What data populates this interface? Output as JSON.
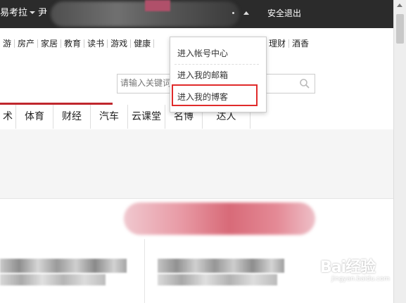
{
  "topbar": {
    "username": "易考拉",
    "user_suffix": "尹",
    "logout_label": "安全退出"
  },
  "nav_categories": [
    "游",
    "房产",
    "家居",
    "教育",
    "读书",
    "游戏",
    "健康",
    "理财",
    "酒香"
  ],
  "search": {
    "placeholder": "请输入关键词"
  },
  "tabs": [
    {
      "label": "术"
    },
    {
      "label": "体育"
    },
    {
      "label": "财经"
    },
    {
      "label": "汽车"
    },
    {
      "label": "云课堂"
    },
    {
      "label": "名博"
    },
    {
      "label": "达人"
    }
  ],
  "dropdown": {
    "items": [
      {
        "label": "进入帐号中心"
      },
      {
        "label": "进入我的邮箱"
      },
      {
        "label": "进入我的博客"
      }
    ],
    "highlighted_index": 2
  },
  "watermark": {
    "brand": "Bai经验",
    "url": "jingyan.baidu.com"
  },
  "colors": {
    "topbar": "#2b2b2b",
    "accent_red": "#c0272d",
    "highlight_box": "#e02a2a"
  }
}
